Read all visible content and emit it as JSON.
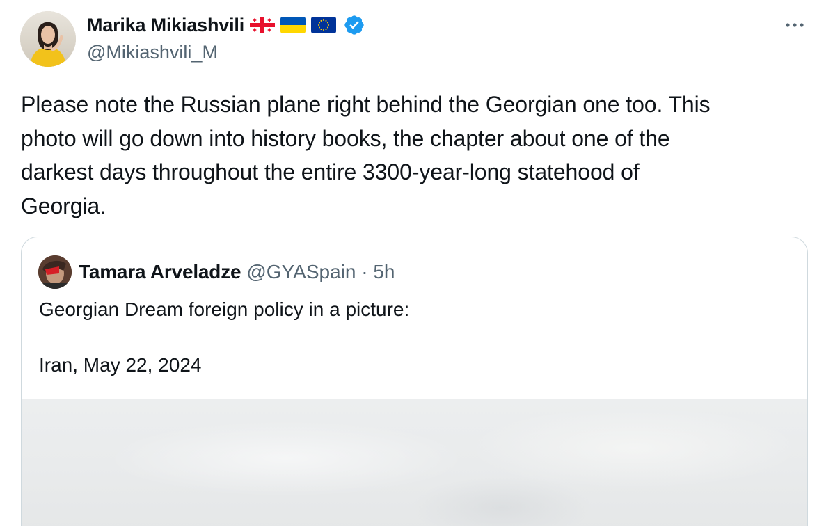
{
  "author": {
    "display_name": "Marika Mikiashvili",
    "handle": "@Mikiashvili_M",
    "badges": [
      "flag-georgia-icon",
      "flag-ukraine-icon",
      "flag-eu-icon",
      "verified-badge-icon"
    ],
    "verified_color": "#1d9bf0"
  },
  "more_menu": {
    "icon": "more-horizontal-icon"
  },
  "tweet": {
    "text": "Please note the Russian plane right behind the Georgian one too. This\nphoto will go down into history books, the chapter about one of the\ndarkest days throughout the entire 3300-year-long statehood of\nGeorgia."
  },
  "quoted_tweet": {
    "display_name": "Tamara Arveladze",
    "meta": "@GYASpain · 5h",
    "text": "Georgian Dream foreign policy in a picture:\n\nIran, May 22, 2024",
    "media": "photo"
  },
  "colors": {
    "text_primary": "#0f1419",
    "text_secondary": "#536471",
    "border": "#cfd9de",
    "accent": "#1d9bf0"
  }
}
